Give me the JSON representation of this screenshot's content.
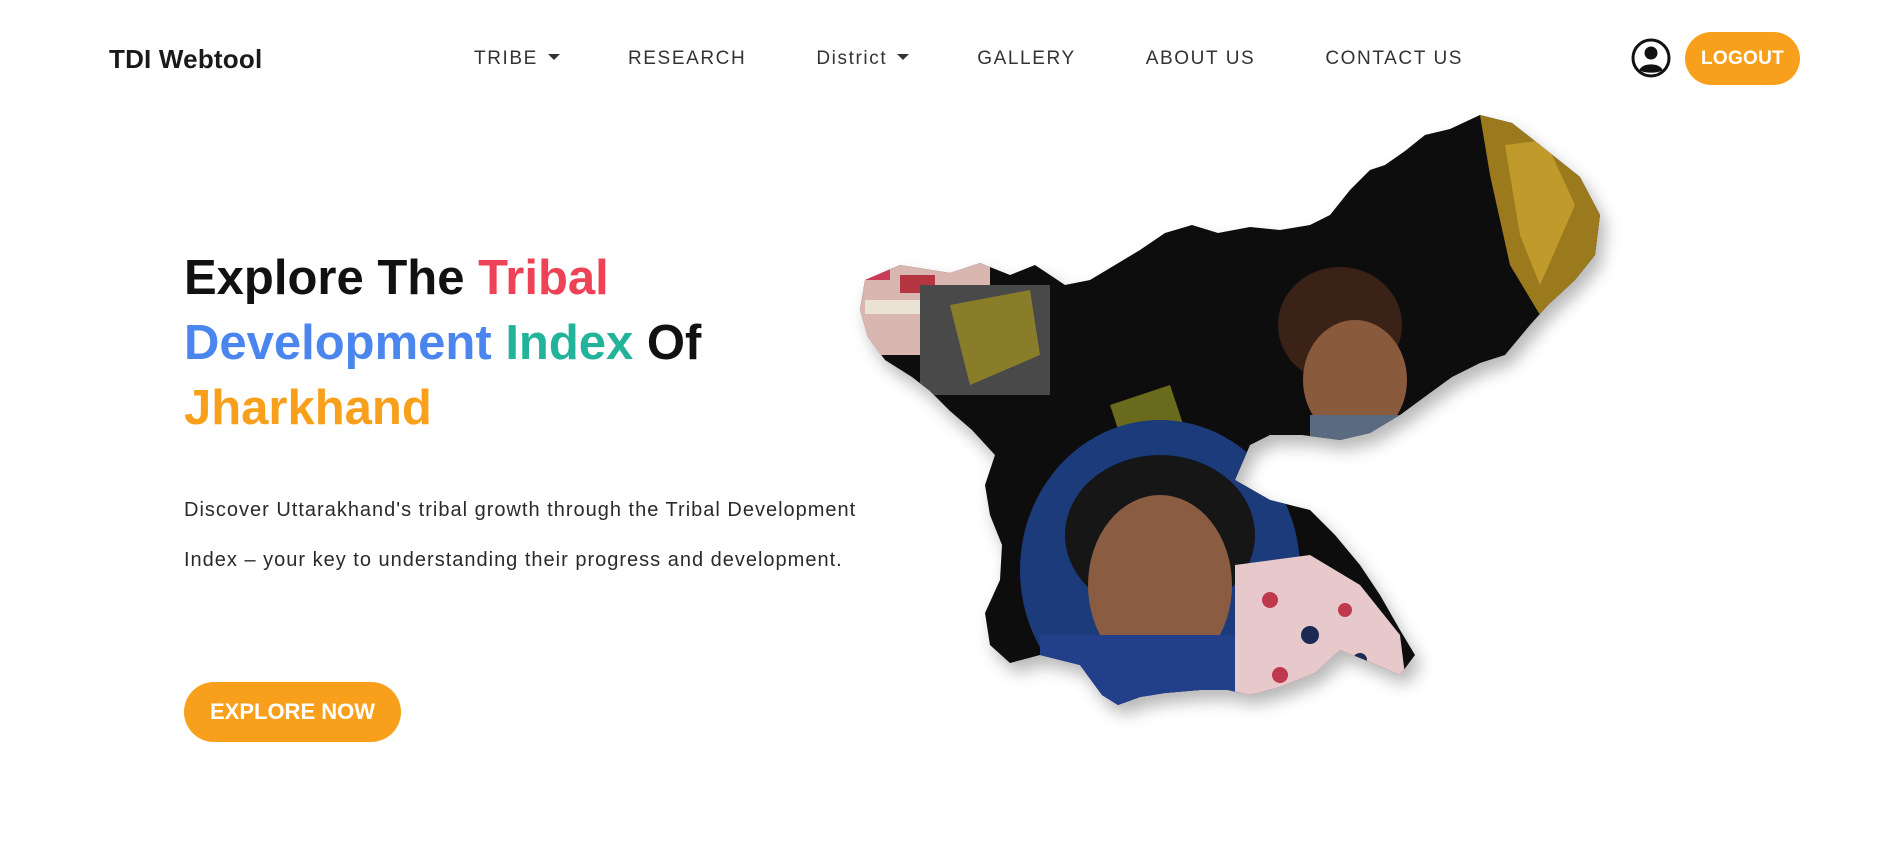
{
  "navbar": {
    "brand": "TDI Webtool",
    "items": [
      {
        "label": "TRIBE",
        "dropdown": true
      },
      {
        "label": "RESEARCH",
        "dropdown": false
      },
      {
        "label": "District",
        "dropdown": true
      },
      {
        "label": "GALLERY",
        "dropdown": false
      },
      {
        "label": "ABOUT US",
        "dropdown": false
      },
      {
        "label": "CONTACT US",
        "dropdown": false
      }
    ],
    "user_icon": "user-circle-icon",
    "logout_label": "LOGOUT"
  },
  "hero": {
    "title": {
      "part1": "Explore The ",
      "part2": "Tribal",
      "part3": "Development",
      "part4": " ",
      "part5": "Index",
      "part6": " Of",
      "part7": "Jharkhand"
    },
    "description": "Discover Uttarakhand's tribal growth through the Tribal Development Index – your key to understanding their progress and development.",
    "cta_label": "EXPLORE NOW",
    "image": "jharkhand-map-photo-collage"
  },
  "colors": {
    "accent_orange": "#f8a01c",
    "title_red": "#ee4256",
    "title_blue": "#4a86ee",
    "title_teal": "#23b39a"
  }
}
